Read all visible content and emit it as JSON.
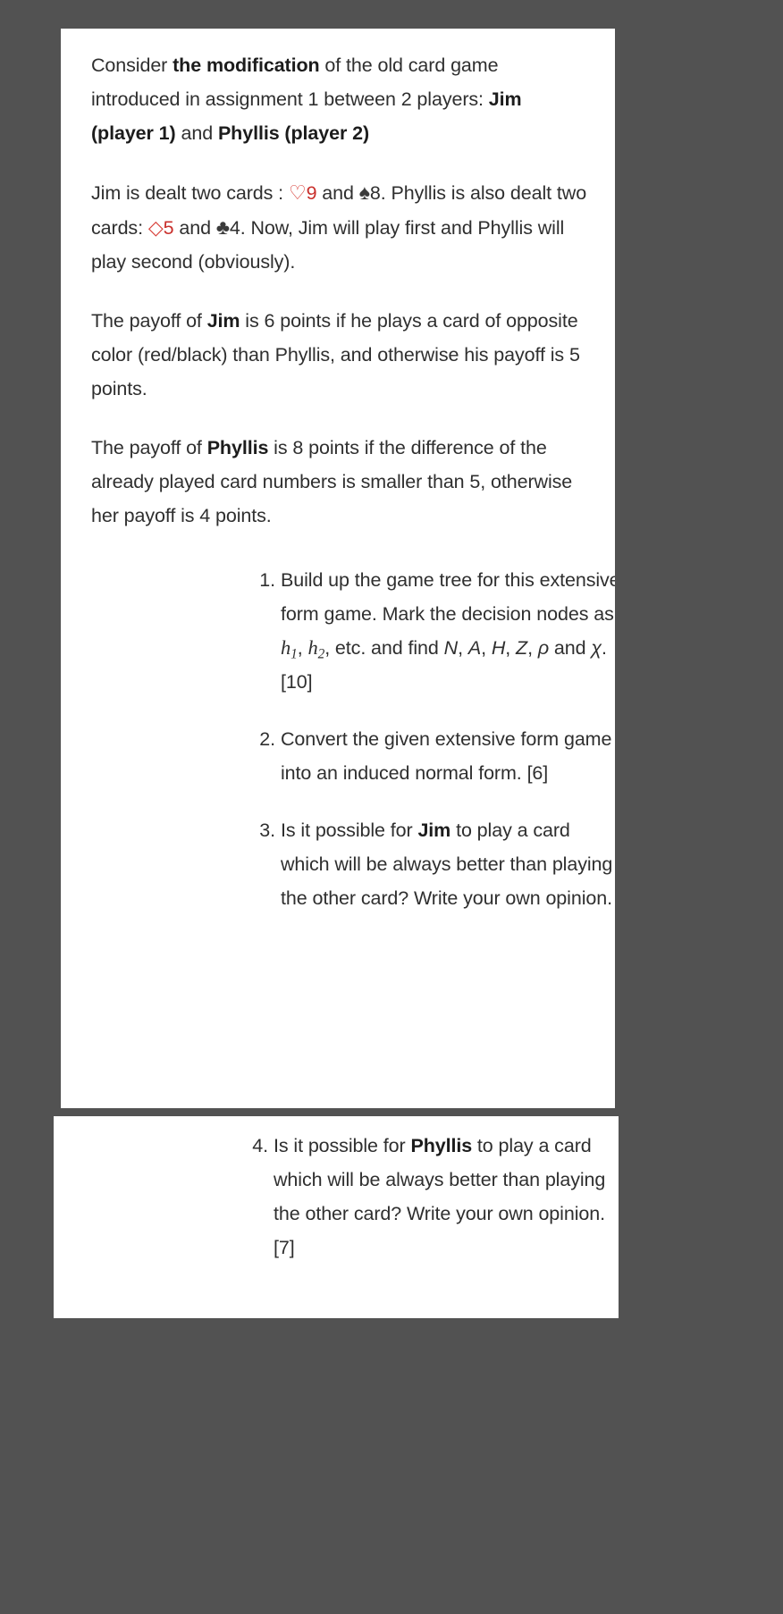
{
  "theme": {
    "background": "#525252",
    "card_background": "#ffffff",
    "text_color": "#2f2f2f",
    "red_suit_color": "#d8413a",
    "red_number_color": "#c9302c",
    "black_suit_color": "#3b3b3b"
  },
  "document": {
    "intro": {
      "t1": "Consider ",
      "b1": "the modification",
      "t2": " of the old card game introduced in assignment 1 between 2 players: ",
      "b2": "Jim (player 1)",
      "t3": " and ",
      "b3": "Phyllis (player 2)"
    },
    "deal": {
      "t1": "Jim is dealt two cards : ",
      "heart_icon": "♡",
      "heart_value": "9",
      "t2": " and ",
      "spade_icon": "♠",
      "spade_value": "8",
      "t3": ". Phyllis is also dealt two cards: ",
      "diamond_icon": "◇",
      "diamond_value": "5",
      "t4": " and ",
      "club_icon": "♣",
      "club_value": "4",
      "t5": ". Now, Jim will play first and Phyllis will play second (obviously)."
    },
    "payoff_jim": {
      "t1": "The payoff of ",
      "b1": "Jim",
      "t2": " is 6 points if he plays a card of opposite color (red/black) than Phyllis, and otherwise his payoff is 5 points."
    },
    "payoff_phyllis": {
      "t1": "The payoff of ",
      "b1": "Phyllis",
      "t2": " is 8 points if the difference of the already played card numbers is smaller than 5, otherwise her payoff is 4 points."
    },
    "questions": {
      "q1": {
        "t1": "Build up the game tree for this extensive form game. Mark the decision nodes as ",
        "h1": "h",
        "h1_sub": "1",
        "t2": ", ",
        "h2": "h",
        "h2_sub": "2",
        "t3": ", etc. and find ",
        "sym_n": "N",
        "t4": ", ",
        "sym_a": "A",
        "t5": ", ",
        "sym_h": "H",
        "t6": ", ",
        "sym_z": "Z",
        "t7": ", ",
        "sym_rho": "ρ",
        "t8": " and ",
        "sym_chi": "χ",
        "t9": ". ",
        "marks": "[10]"
      },
      "q2": {
        "t1": "Convert the given extensive form game into an induced normal form. ",
        "marks": "[6]"
      },
      "q3": {
        "t1": "Is it possible for ",
        "b1": "Jim",
        "t2": " to play a card which will be always better than playing the other card? Write your own opinion."
      },
      "q4": {
        "t1": "Is it possible for ",
        "b1": "Phyllis",
        "t2": " to play a card which will be always better than playing the other card? Write your own opinion. ",
        "marks": "[7]"
      }
    }
  }
}
